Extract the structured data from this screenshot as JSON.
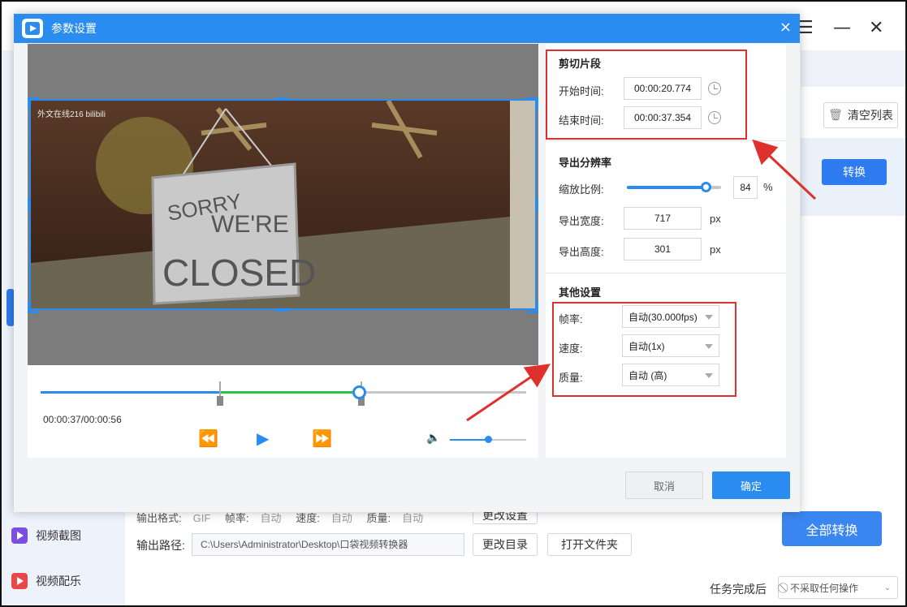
{
  "background_app": {
    "sidebar": [
      {
        "label": "视频截图",
        "icon": "video-screenshot-icon",
        "color": "#7b4de0"
      },
      {
        "label": "视频配乐",
        "icon": "video-music-icon",
        "color": "#e8484a"
      }
    ],
    "clear_list": "清空列表",
    "convert": "转换",
    "convert_all": "全部转换",
    "output_format_row": {
      "format_label": "输出格式:",
      "format_value": "GIF",
      "fps_label": "帧率:",
      "fps_value": "自动",
      "speed_label": "速度:",
      "speed_value": "自动",
      "quality_label": "质量:",
      "quality_value": "自动"
    },
    "change_settings": "更改设置",
    "output_path_label": "输出路径:",
    "output_path_value": "C:\\Users\\Administrator\\Desktop\\口袋视频转换器",
    "change_dir": "更改目录",
    "open_folder": "打开文件夹",
    "after_task_label": "任务完成后",
    "after_task_value": "不采取任何操作"
  },
  "dialog": {
    "title": "参数设置",
    "close": "×",
    "player": {
      "watermark": "外文在线216 bilibili",
      "sign_text_1": "SORRY",
      "sign_text_2": "WE'RE",
      "sign_text_3": "CLOSED",
      "time": "00:00:37/00:00:56",
      "progress": 0.655,
      "clip_start": 0.37,
      "clip_end": 0.66,
      "volume": 0.5
    },
    "cut": {
      "title": "剪切片段",
      "start_label": "开始时间:",
      "start_value": "00:00:20.774",
      "end_label": "结束时间:",
      "end_value": "00:00:37.354"
    },
    "resolution": {
      "title": "导出分辨率",
      "scale_label": "缩放比例:",
      "scale_value": "84",
      "scale_unit": "%",
      "width_label": "导出宽度:",
      "width_value": "717",
      "height_label": "导出高度:",
      "height_value": "301",
      "px": "px"
    },
    "other": {
      "title": "其他设置",
      "fps_label": "帧率:",
      "fps_value": "自动(30.000fps)",
      "speed_label": "速度:",
      "speed_value": "自动(1x)",
      "quality_label": "质量:",
      "quality_value": "自动 (高)"
    },
    "cancel": "取消",
    "ok": "确定"
  },
  "colors": {
    "accent": "#2a8cf0",
    "highlight": "#e0302e",
    "clip": "#2ec04a"
  }
}
